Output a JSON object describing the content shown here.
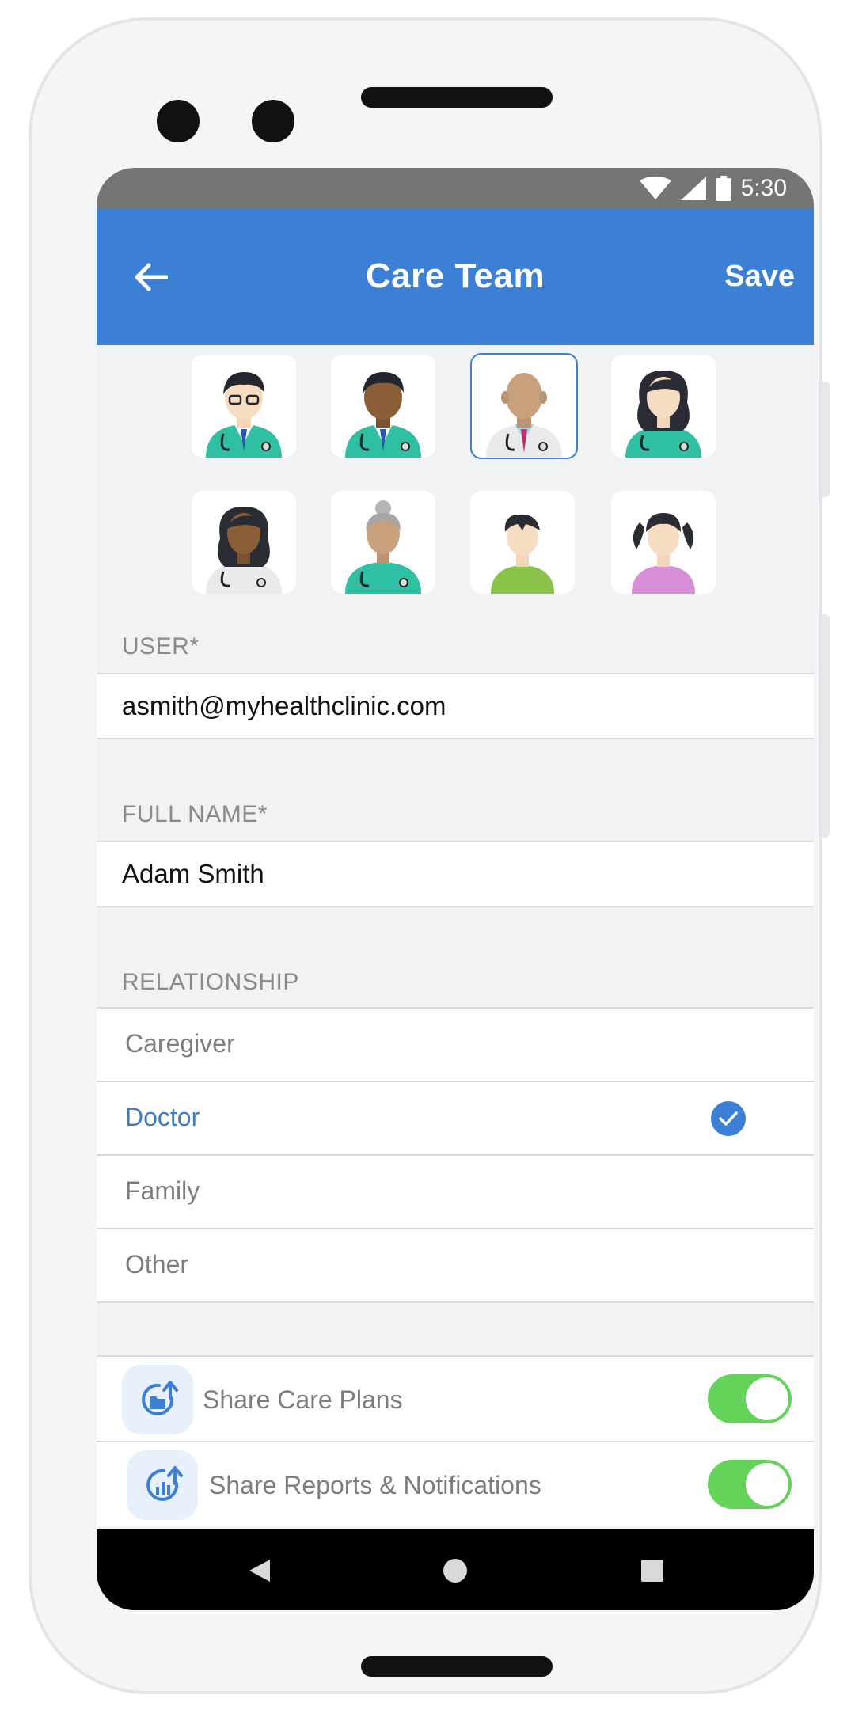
{
  "status_bar": {
    "time": "5:30"
  },
  "app_bar": {
    "title": "Care Team",
    "save_label": "Save"
  },
  "avatars": [
    {
      "name": "doctor-glasses",
      "selected": false
    },
    {
      "name": "doctor-dark-skin",
      "selected": false
    },
    {
      "name": "doctor-bald-labcoat",
      "selected": true
    },
    {
      "name": "doctor-female-black-hair",
      "selected": false
    },
    {
      "name": "doctor-female-dark-skin",
      "selected": false
    },
    {
      "name": "doctor-grey-bun",
      "selected": false
    },
    {
      "name": "boy-green-shirt",
      "selected": false
    },
    {
      "name": "girl-pigtails",
      "selected": false
    }
  ],
  "user": {
    "label": "USER*",
    "value": "asmith@myhealthclinic.com"
  },
  "full_name": {
    "label": "FULL NAME*",
    "value": "Adam Smith"
  },
  "relationship": {
    "label": "RELATIONSHIP",
    "options": [
      {
        "label": "Caregiver",
        "selected": false
      },
      {
        "label": "Doctor",
        "selected": true
      },
      {
        "label": "Family",
        "selected": false
      },
      {
        "label": "Other",
        "selected": false
      }
    ]
  },
  "sharing": [
    {
      "label": "Share Care Plans",
      "icon": "share-folder-icon",
      "enabled": true
    },
    {
      "label": "Share Reports & Notifications",
      "icon": "share-chart-icon",
      "enabled": true
    }
  ],
  "colors": {
    "primary": "#3b80d5",
    "toggle_on": "#63d35a",
    "selected_text": "#3b7cc4"
  }
}
